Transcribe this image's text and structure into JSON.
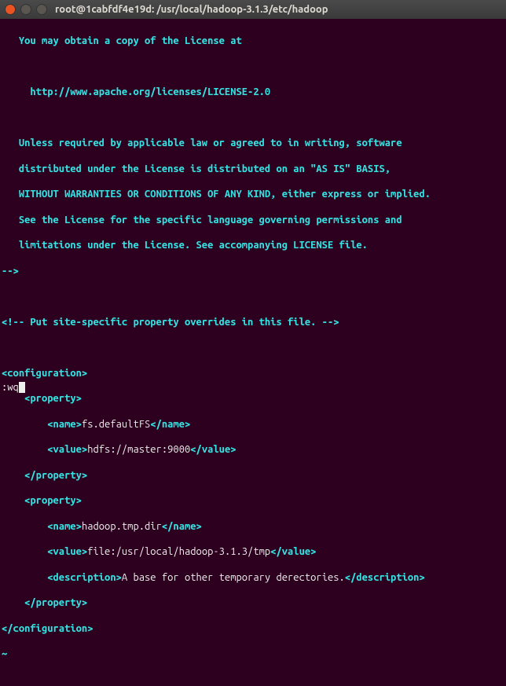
{
  "titlebar": {
    "title": "root@1cabfdf4e19d: /usr/local/hadoop-3.1.3/etc/hadoop"
  },
  "lines": {
    "l1": "   You may obtain a copy of the License at",
    "l2": "     http://www.apache.org/licenses/LICENSE-2.0",
    "l3": "   Unless required by applicable law or agreed to in writing, software",
    "l4": "   distributed under the License is distributed on an \"AS IS\" BASIS,",
    "l5": "   WITHOUT WARRANTIES OR CONDITIONS OF ANY KIND, either express or implied.",
    "l6": "   See the License for the specific language governing permissions and",
    "l7": "   limitations under the License. See accompanying LICENSE file.",
    "l8": "-->",
    "l9": "<!-- Put site-specific property overrides in this file. -->",
    "cfg_open": "<configuration>",
    "prop_open1": "    <property>",
    "name_open1": "        <name>",
    "name_val1": "fs.defaultFS",
    "name_close1": "</name>",
    "value_open1": "        <value>",
    "value_val1": "hdfs://master:9000",
    "value_close1": "</value>",
    "prop_close1": "    </property>",
    "prop_open2": "    <property>",
    "name_open2": "        <name>",
    "name_val2": "hadoop.tmp.dir",
    "name_close2": "</name>",
    "value_open2": "        <value>",
    "value_val2": "file:/usr/local/hadoop-3.1.3/tmp",
    "value_close2": "</value>",
    "desc_open": "        <description>",
    "desc_val": "A base for other temporary derectories.",
    "desc_close": "</description>",
    "prop_close2": "    </property>",
    "cfg_close": "</configuration>",
    "tilde": "~"
  },
  "cmd": ":wq"
}
